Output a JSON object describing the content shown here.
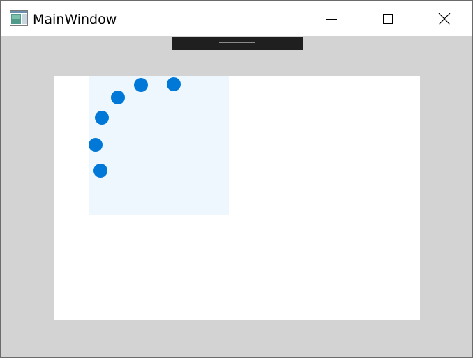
{
  "window": {
    "title": "MainWindow"
  },
  "titlebar": {
    "app_icon": "window-app-icon",
    "buttons": [
      {
        "name": "minimize",
        "icon": "minimize-icon"
      },
      {
        "name": "maximize",
        "icon": "maximize-icon"
      },
      {
        "name": "close",
        "icon": "close-icon"
      }
    ]
  },
  "spinner": {
    "dot_count": 5
  },
  "colors": {
    "window_background": "#d3d3d3",
    "canvas_background": "#ffffff",
    "panel_background": "#eef6fe",
    "dot_color": "#0078d7",
    "handle_color": "#1f1f1f"
  }
}
